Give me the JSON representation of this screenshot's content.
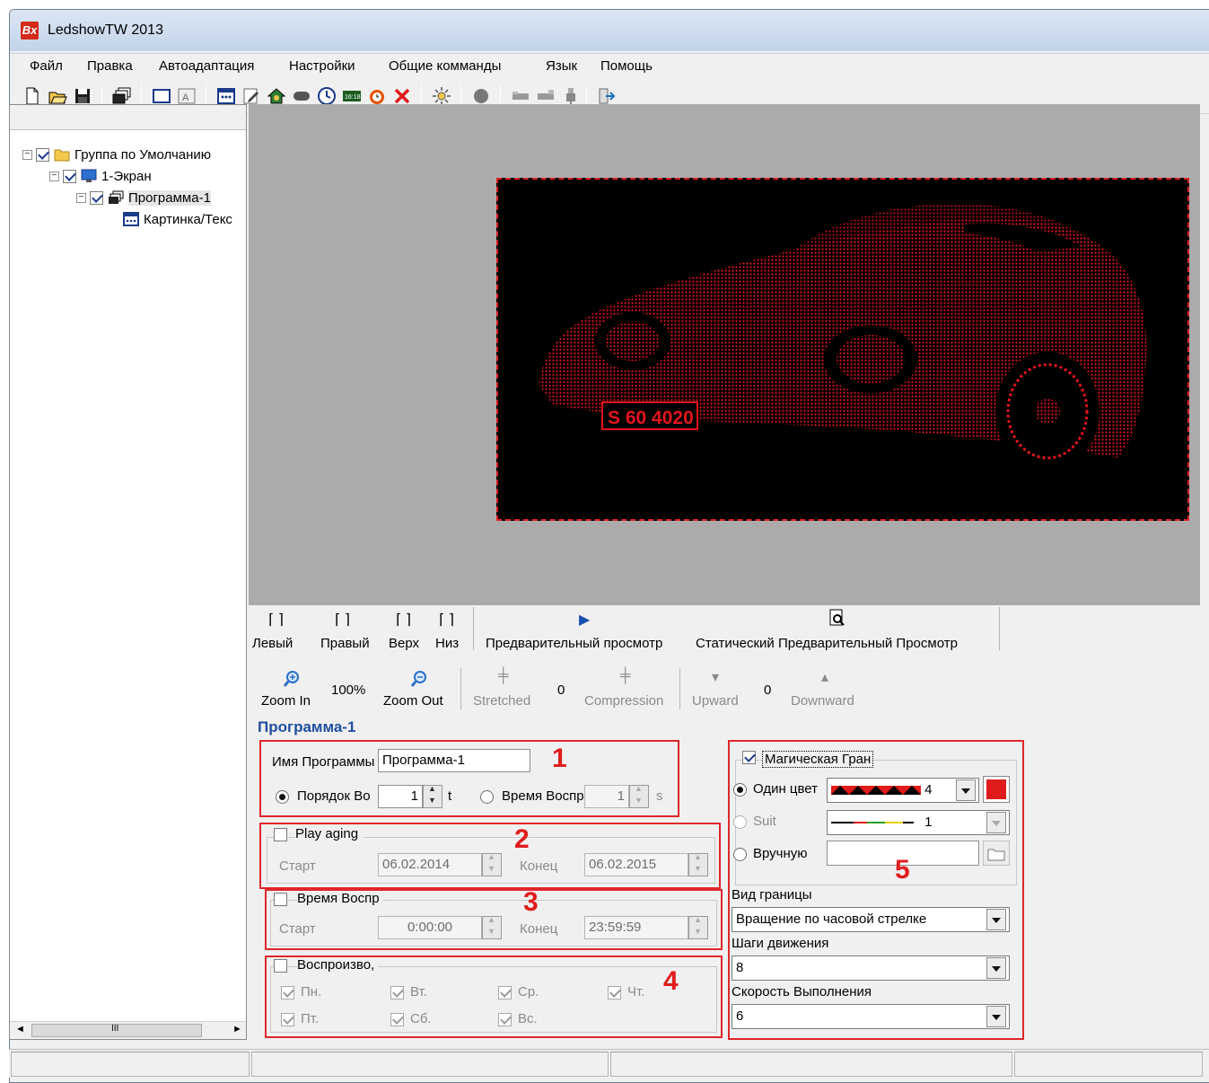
{
  "window": {
    "title": "LedshowTW 2013",
    "app_icon": "Bx"
  },
  "menu": [
    "Файл",
    "Правка",
    "Автоадаптация",
    "Настройки",
    "Общие комманды",
    "Язык",
    "Помощь"
  ],
  "tree": {
    "group": "Группа по Умолчанию",
    "screen": "1-Экран",
    "program": "Программа-1",
    "item": "Картинка/Текс"
  },
  "align_toolbar": {
    "left": "Левый",
    "right": "Правый",
    "top": "Верх",
    "bottom": "Низ",
    "preview": "Предварительный просмотр",
    "static_preview": "Статический Предварительный Просмотр"
  },
  "zoom_toolbar": {
    "zoom_in": "Zoom In",
    "zoom_value": "100%",
    "zoom_out": "Zoom Out",
    "stretched": "Stretched",
    "stretch_value": "0",
    "compression": "Compression",
    "upward": "Upward",
    "move_value": "0",
    "downward": "Downward"
  },
  "led_preview": {
    "plate_text": "S 60 4020"
  },
  "program_panel": {
    "title": "Программа-1",
    "name_label": "Имя Программы",
    "name_value": "Программа-1",
    "order_label": "Порядок Во",
    "order_value": "1",
    "order_unit": "t",
    "time_label": "Время Воспр",
    "time_value": "1",
    "time_unit": "s"
  },
  "play_aging": {
    "label": "Play aging",
    "start_label": "Старт",
    "start_value": "06.02.2014",
    "end_label": "Конец",
    "end_value": "06.02.2015"
  },
  "play_time": {
    "label": "Время Воспр",
    "start_label": "Старт",
    "start_value": "0:00:00",
    "end_label": "Конец",
    "end_value": "23:59:59"
  },
  "playback_days": {
    "label": "Воспроизво,",
    "days": [
      "Пн.",
      "Вт.",
      "Ср.",
      "Чт.",
      "Пт.",
      "Сб.",
      "Вс."
    ]
  },
  "magic_border": {
    "label": "Магическая Гран",
    "single_color": "Один цвет",
    "single_color_value": "4",
    "suit": "Suit",
    "suit_value": "1",
    "manual": "Вручную",
    "border_type_label": "Вид границы",
    "border_type_value": "Вращение по часовой стрелке",
    "steps_label": "Шаги движения",
    "steps_value": "8",
    "speed_label": "Скорость Выполнения",
    "speed_value": "6",
    "swatch_color": "#e01b1b"
  },
  "callouts": [
    "1",
    "2",
    "3",
    "4",
    "5"
  ],
  "scrollbar": {
    "grip": "III"
  },
  "colors": {
    "accent_red": "#e0262a",
    "title_blue": "#1f4e9e",
    "led_red": "#e3141b"
  }
}
